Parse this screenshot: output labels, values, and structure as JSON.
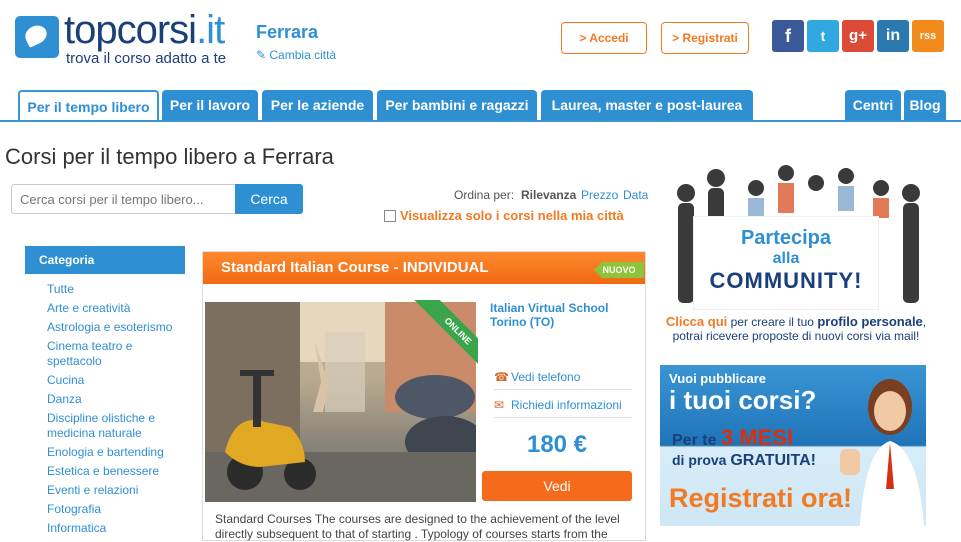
{
  "header": {
    "logo_main": "topcorsi",
    "logo_suffix": ".it",
    "logo_tagline": "trova il corso adatto a te",
    "city": "Ferrara",
    "change_city": "Cambia città",
    "login": "> Accedi",
    "register": "> Registrati",
    "social": [
      "f",
      "t",
      "g+",
      "in",
      "rss"
    ]
  },
  "tabs": [
    {
      "label": "Per il tempo libero",
      "active": true
    },
    {
      "label": "Per il lavoro"
    },
    {
      "label": "Per le aziende"
    },
    {
      "label": "Per bambini e ragazzi"
    },
    {
      "label": "Laurea, master e post-laurea"
    },
    {
      "label": "Centri"
    },
    {
      "label": "Blog"
    }
  ],
  "main": {
    "title": "Corsi per il tempo libero a Ferrara",
    "search_placeholder": "Cerca corsi per il tempo libero...",
    "search_button": "Cerca",
    "sort_label": "Ordina per:",
    "sort_options": [
      "Rilevanza",
      "Prezzo",
      "Data"
    ],
    "city_only": "Visualizza solo i corsi nella mia città"
  },
  "sidebar": {
    "heading": "Categoria",
    "items": [
      "Tutte",
      "Arte e creatività",
      "Astrologia e esoterismo",
      "Cinema teatro e spettacolo",
      "Cucina",
      "Danza",
      "Discipline olistiche e medicina naturale",
      "Enologia e bartending",
      "Estetica e benessere",
      "Eventi e relazioni",
      "Fotografia",
      "Informatica"
    ]
  },
  "course": {
    "title": "Standard Italian Course - INDIVIDUAL",
    "badge": "NUOVO",
    "ribbon": "ONLINE",
    "school": "Italian Virtual School",
    "location": "Torino (TO)",
    "phone": "Vedi telefono",
    "info": "Richiedi informazioni",
    "price": "180 €",
    "button": "Vedi",
    "description": "Standard Courses The courses are designed to the achievement of the level directly subsequent to that of starting . Typology of courses starts from the"
  },
  "community_ad": {
    "line1": "Partecipa",
    "line2": "alla",
    "line3": "COMMUNITY!",
    "cta_link": "Clicca qui",
    "cta_text": "per creare il tuo",
    "cta_bold": "profilo personale",
    "cta_text2": "potrai ricevere proposte di nuovi corsi via mail!"
  },
  "promo_ad": {
    "line1": "Vuoi pubblicare",
    "line2": "i tuoi corsi?",
    "line3": "Per te",
    "line3b": "3 MESI",
    "line4": "di prova",
    "line4b": "GRATUITA!",
    "line5": "Registrati ora!"
  }
}
